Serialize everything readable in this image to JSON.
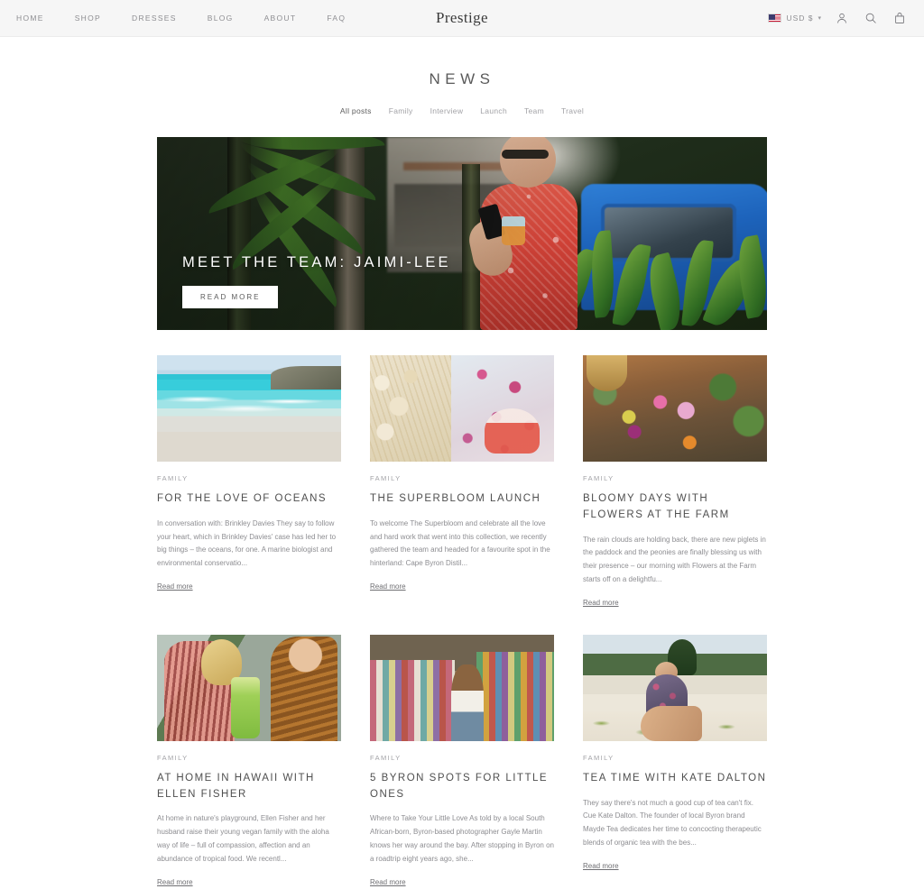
{
  "header": {
    "nav": [
      {
        "label": "HOME",
        "name": "nav-home"
      },
      {
        "label": "SHOP",
        "name": "nav-shop"
      },
      {
        "label": "DRESSES",
        "name": "nav-dresses"
      },
      {
        "label": "BLOG",
        "name": "nav-blog"
      },
      {
        "label": "ABOUT",
        "name": "nav-about"
      },
      {
        "label": "FAQ",
        "name": "nav-faq"
      }
    ],
    "brand": "Prestige",
    "currency": {
      "flag": "us-flag-icon",
      "label": "USD $",
      "chevron": "⌄"
    },
    "icons": {
      "account": "account-icon",
      "search": "search-icon",
      "cart": "cart-icon"
    },
    "background": "#f6f6f6"
  },
  "page": {
    "title": "NEWS",
    "filters": [
      {
        "label": "All posts",
        "active": true
      },
      {
        "label": "Family",
        "active": false
      },
      {
        "label": "Interview",
        "active": false
      },
      {
        "label": "Launch",
        "active": false
      },
      {
        "label": "Team",
        "active": false
      },
      {
        "label": "Travel",
        "active": false
      }
    ]
  },
  "hero": {
    "title": "MEET THE TEAM: JAIMI-LEE",
    "button": "READ MORE",
    "image_alt": "woman-in-red-dress-holding-phone-and-drink-tropical-street"
  },
  "posts": [
    {
      "tag": "FAMILY",
      "title": "FOR THE LOVE OF OCEANS",
      "excerpt": "In conversation with: Brinkley Davies They say to follow your heart, which in Brinkley Davies' case has led her to big things – the oceans, for one. A marine biologist and environmental conservatio...",
      "read_more": "Read more",
      "image_alt": "turquoise-ocean-waves-on-white-sand-beach"
    },
    {
      "tag": "FAMILY",
      "title": "THE SUPERBLOOM LAUNCH",
      "excerpt": "To welcome The Superbloom and celebrate all the love and hard work that went into this collection, we recently gathered the team and headed for a favourite spot in the hinterland: Cape Byron Distil...",
      "read_more": "Read more",
      "image_alt": "dried-flowers-and-floral-dress-with-pink-drink"
    },
    {
      "tag": "FAMILY",
      "title": "BLOOMY DAYS WITH FLOWERS AT THE FARM",
      "excerpt": "The rain clouds are holding back, there are new piglets in the paddock and the peonies are finally blessing us with their presence – our morning with Flowers at the Farm starts off on a delightfu...",
      "read_more": "Read more",
      "image_alt": "rustic-flower-shop-with-potted-plants-and-blooms"
    },
    {
      "tag": "FAMILY",
      "title": "AT HOME IN HAWAII WITH ELLEN FISHER",
      "excerpt": "At home in nature's playground, Ellen Fisher and her husband raise their young vegan family with the aloha way of life – full of compassion, affection and an abundance of tropical food. We recentl...",
      "read_more": "Read more",
      "image_alt": "boy-drinking-green-smoothie-with-mother-and-toddler"
    },
    {
      "tag": "FAMILY",
      "title": "5 BYRON SPOTS FOR LITTLE ONES",
      "excerpt": "Where to Take Your Little Love As told by a local South African-born, Byron-based photographer Gayle Martin knows her way around the bay. After stopping in Byron on a roadtrip eight years ago, she...",
      "read_more": "Read more",
      "image_alt": "child-at-colourful-picket-fence-playground"
    },
    {
      "tag": "FAMILY",
      "title": "TEA TIME WITH KATE DALTON",
      "excerpt": "They say there's not much a good cup of tea can't fix. Cue Kate Dalton. The founder of local Byron brand Mayde Tea dedicates her time to concocting therapeutic blends of organic tea with the bes...",
      "read_more": "Read more",
      "image_alt": "woman-sitting-on-sandy-beach-in-floral-playsuit"
    }
  ]
}
